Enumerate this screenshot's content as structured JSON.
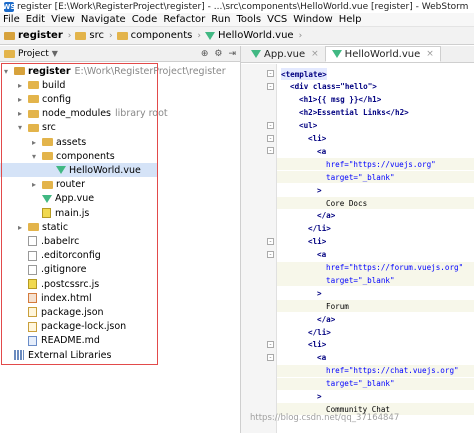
{
  "window": {
    "title": "register [E:\\Work\\RegisterProject\\register] - ...\\src\\components\\HelloWorld.vue [register] - WebStorm"
  },
  "menu": [
    "File",
    "Edit",
    "View",
    "Navigate",
    "Code",
    "Refactor",
    "Run",
    "Tools",
    "VCS",
    "Window",
    "Help"
  ],
  "breadcrumbs": [
    "register",
    "src",
    "components",
    "HelloWorld.vue"
  ],
  "project_panel": {
    "title": "Project"
  },
  "tree": [
    {
      "label": "register",
      "extra": "E:\\Work\\RegisterProject\\register",
      "indent": 0,
      "type": "root",
      "expanded": true
    },
    {
      "label": "build",
      "indent": 1,
      "type": "folder",
      "expanded": false
    },
    {
      "label": "config",
      "indent": 1,
      "type": "folder",
      "expanded": false
    },
    {
      "label": "node_modules",
      "extra": "library root",
      "indent": 1,
      "type": "folder",
      "expanded": false
    },
    {
      "label": "src",
      "indent": 1,
      "type": "folder",
      "expanded": true
    },
    {
      "label": "assets",
      "indent": 2,
      "type": "folder",
      "expanded": false
    },
    {
      "label": "components",
      "indent": 2,
      "type": "folder",
      "expanded": true
    },
    {
      "label": "HelloWorld.vue",
      "indent": 3,
      "type": "vue",
      "selected": true
    },
    {
      "label": "router",
      "indent": 2,
      "type": "folder",
      "expanded": false
    },
    {
      "label": "App.vue",
      "indent": 2,
      "type": "vue"
    },
    {
      "label": "main.js",
      "indent": 2,
      "type": "js"
    },
    {
      "label": "static",
      "indent": 1,
      "type": "folder",
      "expanded": false
    },
    {
      "label": ".babelrc",
      "indent": 1,
      "type": "file"
    },
    {
      "label": ".editorconfig",
      "indent": 1,
      "type": "file"
    },
    {
      "label": ".gitignore",
      "indent": 1,
      "type": "file"
    },
    {
      "label": ".postcssrc.js",
      "indent": 1,
      "type": "js"
    },
    {
      "label": "index.html",
      "indent": 1,
      "type": "html"
    },
    {
      "label": "package.json",
      "indent": 1,
      "type": "json"
    },
    {
      "label": "package-lock.json",
      "indent": 1,
      "type": "json"
    },
    {
      "label": "README.md",
      "indent": 1,
      "type": "md"
    },
    {
      "label": "External Libraries",
      "indent": 0,
      "type": "lib"
    }
  ],
  "tabs": [
    {
      "label": "App.vue",
      "active": false
    },
    {
      "label": "HelloWorld.vue",
      "active": true
    }
  ],
  "code_lines": [
    {
      "indent": 0,
      "text": "<template>",
      "kind": "tpl"
    },
    {
      "indent": 1,
      "text": "<div class=\"hello\">",
      "kind": "tag"
    },
    {
      "indent": 2,
      "text": "<h1>{{ msg }}</h1>",
      "kind": "tag"
    },
    {
      "indent": 2,
      "text": "<h2>Essential Links</h2>",
      "kind": "tag"
    },
    {
      "indent": 2,
      "text": "<ul>",
      "kind": "tag"
    },
    {
      "indent": 3,
      "text": "<li>",
      "kind": "tag"
    },
    {
      "indent": 4,
      "text": "<a",
      "kind": "tag"
    },
    {
      "indent": 5,
      "text": "href=\"https://vuejs.org\"",
      "kind": "attr"
    },
    {
      "indent": 5,
      "text": "target=\"_blank\"",
      "kind": "attr"
    },
    {
      "indent": 4,
      "text": ">",
      "kind": "tag"
    },
    {
      "indent": 5,
      "text": "Core Docs",
      "kind": "text"
    },
    {
      "indent": 4,
      "text": "</a>",
      "kind": "tag"
    },
    {
      "indent": 3,
      "text": "</li>",
      "kind": "tag"
    },
    {
      "indent": 3,
      "text": "<li>",
      "kind": "tag"
    },
    {
      "indent": 4,
      "text": "<a",
      "kind": "tag"
    },
    {
      "indent": 5,
      "text": "href=\"https://forum.vuejs.org\"",
      "kind": "attr"
    },
    {
      "indent": 5,
      "text": "target=\"_blank\"",
      "kind": "attr"
    },
    {
      "indent": 4,
      "text": ">",
      "kind": "tag"
    },
    {
      "indent": 5,
      "text": "Forum",
      "kind": "text"
    },
    {
      "indent": 4,
      "text": "</a>",
      "kind": "tag"
    },
    {
      "indent": 3,
      "text": "</li>",
      "kind": "tag"
    },
    {
      "indent": 3,
      "text": "<li>",
      "kind": "tag"
    },
    {
      "indent": 4,
      "text": "<a",
      "kind": "tag"
    },
    {
      "indent": 5,
      "text": "href=\"https://chat.vuejs.org\"",
      "kind": "attr"
    },
    {
      "indent": 5,
      "text": "target=\"_blank\"",
      "kind": "attr"
    },
    {
      "indent": 4,
      "text": ">",
      "kind": "tag"
    },
    {
      "indent": 5,
      "text": "Community Chat",
      "kind": "text"
    }
  ],
  "watermark": "https://blog.csdn.net/qq_37164847",
  "colors": {
    "vue": "#41b883",
    "folder": "#e3b44b",
    "highlight_box": "#e24a4a",
    "selection": "#d5e3f7"
  }
}
